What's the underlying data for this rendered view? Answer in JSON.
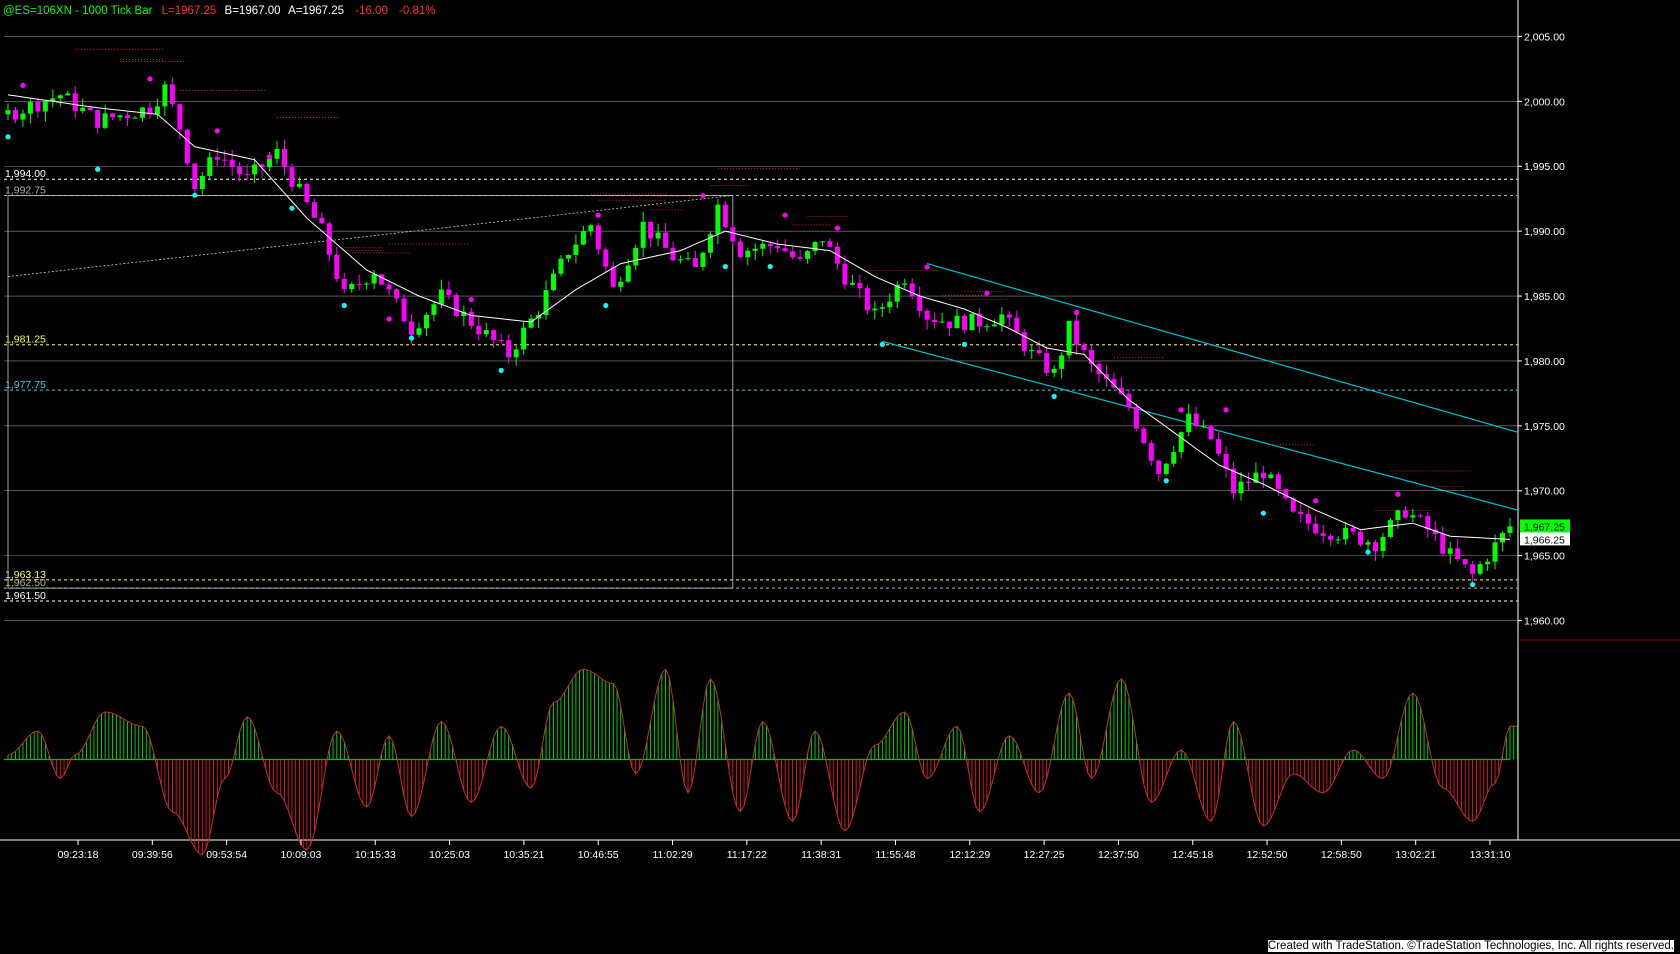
{
  "header": {
    "symbol": "@ES=106XN - 1000 Tick Bar",
    "last": "L=1967.25",
    "bid": "B=1967.00",
    "ask": "A=1967.25",
    "change": "-16.00",
    "change_pct": "-0.81%"
  },
  "footer": "Created with TradeStation. ©TradeStation Technologies, Inc. All rights reserved.",
  "colors": {
    "background": "#000000",
    "up_bar": "#00ff00",
    "down_bar": "#ff00ff",
    "moving_average": "#ffffff",
    "channel": "#00c0d0",
    "swing_high_dot": "#ff00ff",
    "swing_low_dot": "#00ffff",
    "osc_positive": "#00ff00",
    "osc_negative": "#ff2020",
    "grid": "#8a8a8a"
  },
  "chart_data": [
    {
      "type": "candlestick",
      "ylim": [
        1958.5,
        2007.5
      ],
      "y_ticks": [
        2005,
        2000,
        1995,
        1990,
        1985,
        1980,
        1975,
        1970,
        1965,
        1960
      ],
      "y_tick_labels": [
        "2,005.00",
        "2,000.00",
        "1,995.00",
        "1,990.00",
        "1,985.00",
        "1,980.00",
        "1,975.00",
        "1,970.00",
        "1,965.00",
        "1,960.00"
      ],
      "x_tick_labels": [
        "09:23:18",
        "09:39:56",
        "09:53:54",
        "10:09:03",
        "10:15:33",
        "10:25:03",
        "10:35:21",
        "10:46:55",
        "11:02:29",
        "11:17:22",
        "11:38:31",
        "11:55:48",
        "12:12:29",
        "12:27:25",
        "12:37:50",
        "12:45:18",
        "12:52:50",
        "12:58:50",
        "13:02:21",
        "13:31:10"
      ],
      "bar_count": 202,
      "price_path": [
        [
          0,
          1999.0
        ],
        [
          7,
          2000.5
        ],
        [
          12,
          1998.5
        ],
        [
          19,
          1999.5
        ],
        [
          21,
          2001.0
        ],
        [
          23,
          1998.0
        ],
        [
          25,
          1993.5
        ],
        [
          28,
          1996.0
        ],
        [
          32,
          1994.0
        ],
        [
          36,
          1996.0
        ],
        [
          42,
          1990.0
        ],
        [
          45,
          1985.0
        ],
        [
          49,
          1987.0
        ],
        [
          54,
          1982.5
        ],
        [
          58,
          1985.0
        ],
        [
          62,
          1983.0
        ],
        [
          67,
          1980.5
        ],
        [
          71,
          1984.0
        ],
        [
          75,
          1988.5
        ],
        [
          78,
          1990.5
        ],
        [
          81,
          1985.5
        ],
        [
          85,
          1990.5
        ],
        [
          89,
          1988.0
        ],
        [
          92,
          1987.0
        ],
        [
          95,
          1992.0
        ],
        [
          98,
          1988.5
        ],
        [
          103,
          1989.0
        ],
        [
          106,
          1987.5
        ],
        [
          109,
          1989.5
        ],
        [
          112,
          1986.5
        ],
        [
          116,
          1983.5
        ],
        [
          120,
          1986.5
        ],
        [
          123,
          1983.5
        ],
        [
          126,
          1983.0
        ],
        [
          130,
          1983.0
        ],
        [
          133,
          1983.5
        ],
        [
          137,
          1980.5
        ],
        [
          140,
          1979.0
        ],
        [
          142,
          1982.5
        ],
        [
          145,
          1979.5
        ],
        [
          150,
          1976.5
        ],
        [
          154,
          1971.5
        ],
        [
          158,
          1975.5
        ],
        [
          161,
          1974.0
        ],
        [
          164,
          1970.0
        ],
        [
          168,
          1971.5
        ],
        [
          172,
          1968.0
        ],
        [
          176,
          1967.0
        ],
        [
          180,
          1966.5
        ],
        [
          183,
          1966.0
        ],
        [
          187,
          1968.5
        ],
        [
          190,
          1967.0
        ],
        [
          193,
          1965.0
        ],
        [
          196,
          1963.5
        ],
        [
          201,
          1967.25
        ]
      ],
      "moving_average_path": [
        [
          0,
          2000.5
        ],
        [
          12,
          1999.5
        ],
        [
          20,
          1999.0
        ],
        [
          25,
          1996.5
        ],
        [
          33,
          1995.5
        ],
        [
          40,
          1991.0
        ],
        [
          48,
          1987.0
        ],
        [
          55,
          1985.0
        ],
        [
          62,
          1983.5
        ],
        [
          70,
          1983.0
        ],
        [
          76,
          1985.5
        ],
        [
          82,
          1987.5
        ],
        [
          90,
          1988.5
        ],
        [
          96,
          1990.0
        ],
        [
          103,
          1989.0
        ],
        [
          110,
          1988.5
        ],
        [
          116,
          1986.5
        ],
        [
          122,
          1985.0
        ],
        [
          128,
          1984.0
        ],
        [
          134,
          1982.5
        ],
        [
          139,
          1981.0
        ],
        [
          144,
          1980.5
        ],
        [
          150,
          1977.0
        ],
        [
          156,
          1974.5
        ],
        [
          162,
          1972.0
        ],
        [
          168,
          1970.5
        ],
        [
          175,
          1968.5
        ],
        [
          181,
          1967.0
        ],
        [
          188,
          1967.5
        ],
        [
          193,
          1966.5
        ],
        [
          201,
          1966.25
        ]
      ],
      "swing_highs": [
        [
          2,
          2001.0
        ],
        [
          19,
          2001.5
        ],
        [
          28,
          1997.5
        ],
        [
          35,
          1995.5
        ],
        [
          51,
          1983.0
        ],
        [
          62,
          1984.5
        ],
        [
          79,
          1991.0
        ],
        [
          93,
          1992.5
        ],
        [
          104,
          1991.0
        ],
        [
          111,
          1990.0
        ],
        [
          123,
          1987.0
        ],
        [
          131,
          1985.0
        ],
        [
          143,
          1983.5
        ],
        [
          157,
          1976.0
        ],
        [
          163,
          1976.0
        ],
        [
          175,
          1969.0
        ],
        [
          186,
          1969.5
        ]
      ],
      "swing_lows": [
        [
          0,
          1997.5
        ],
        [
          12,
          1995.0
        ],
        [
          25,
          1993.0
        ],
        [
          38,
          1992.0
        ],
        [
          45,
          1984.5
        ],
        [
          54,
          1982.0
        ],
        [
          66,
          1979.5
        ],
        [
          80,
          1984.5
        ],
        [
          96,
          1987.5
        ],
        [
          102,
          1987.5
        ],
        [
          117,
          1981.5
        ],
        [
          128,
          1981.5
        ],
        [
          140,
          1977.5
        ],
        [
          155,
          1971.0
        ],
        [
          168,
          1968.5
        ],
        [
          182,
          1965.5
        ],
        [
          196,
          1963.0
        ]
      ],
      "levels": [
        {
          "label": "1,994.00",
          "value": 1994.0,
          "color": "#ffffff"
        },
        {
          "label": "1,992.75",
          "value": 1992.75,
          "color": "#b0b0b0"
        },
        {
          "label": "1,981.25",
          "value": 1981.25,
          "color": "#ffff40"
        },
        {
          "label": "1,977.75",
          "value": 1977.75,
          "color": "#40c8e0"
        },
        {
          "label": "1,963.13",
          "value": 1963.13,
          "color": "#ffff40"
        },
        {
          "label": "1,962.50",
          "value": 1962.5,
          "color": "#b0b0b0"
        },
        {
          "label": "1,961.50",
          "value": 1961.5,
          "color": "#ffffff"
        }
      ],
      "price_flags": [
        {
          "label": "1,967.25",
          "value": 1967.25,
          "bg": "#00ff00",
          "fg": "#000000"
        },
        {
          "label": "1,966.25",
          "value": 1966.25,
          "bg": "#ffffff",
          "fg": "#000000"
        }
      ],
      "channel_upper": [
        [
          123,
          1987.5
        ],
        [
          201,
          1974.5
        ]
      ],
      "channel_lower": [
        [
          117,
          1981.5
        ],
        [
          201,
          1968.5
        ]
      ],
      "dotted_trendline": [
        [
          0,
          1986.5
        ],
        [
          97,
          1992.75
        ]
      ],
      "measure_box": {
        "bar_from": 0,
        "bar_to": 97,
        "high": 1992.75,
        "low": 1962.5
      }
    },
    {
      "type": "oscillator",
      "ylim": [
        -1.0,
        1.0
      ],
      "x": [
        0,
        4,
        7,
        9,
        13,
        18,
        22,
        26,
        29,
        32,
        36,
        40,
        44,
        48,
        51,
        54,
        58,
        62,
        66,
        70,
        73,
        77,
        81,
        84,
        88,
        91,
        94,
        98,
        101,
        105,
        108,
        112,
        116,
        120,
        123,
        127,
        130,
        134,
        138,
        142,
        145,
        149,
        153,
        157,
        161,
        164,
        168,
        172,
        176,
        180,
        184,
        188,
        192,
        196,
        199,
        201
      ],
      "values": [
        0.05,
        0.3,
        -0.2,
        0.05,
        0.5,
        0.35,
        -0.55,
        -1.0,
        -0.2,
        0.45,
        -0.35,
        -0.95,
        0.3,
        -0.5,
        0.25,
        -0.6,
        0.4,
        -0.45,
        0.35,
        -0.3,
        0.6,
        0.95,
        0.8,
        -0.15,
        0.95,
        -0.35,
        0.85,
        -0.55,
        0.4,
        -0.65,
        0.3,
        -0.75,
        0.15,
        0.5,
        -0.2,
        0.35,
        -0.55,
        0.25,
        -0.35,
        0.7,
        -0.2,
        0.85,
        -0.45,
        0.1,
        -0.65,
        0.4,
        -0.7,
        -0.15,
        -0.35,
        0.1,
        -0.2,
        0.7,
        -0.3,
        -0.65,
        -0.25,
        0.35
      ]
    }
  ]
}
